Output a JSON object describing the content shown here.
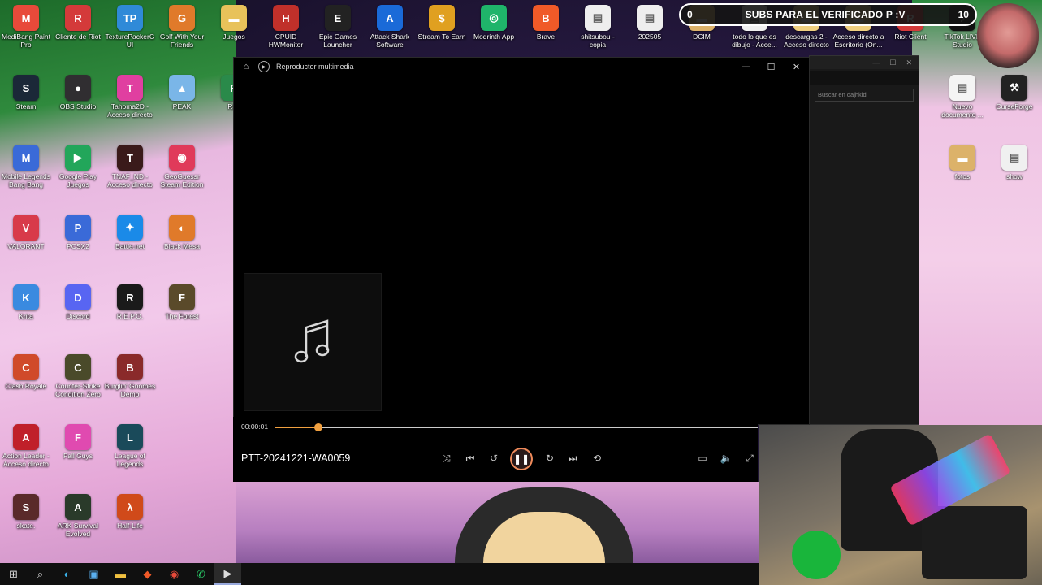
{
  "desktop_icons": [
    {
      "label": "MediBang Paint Pro",
      "color": "#e84a3a",
      "glyph": "M"
    },
    {
      "label": "Cliente de Riot",
      "color": "#d43a3a",
      "glyph": "R"
    },
    {
      "label": "TexturePackerGUI",
      "color": "#2f8ad8",
      "glyph": "TP"
    },
    {
      "label": "Golf With Your Friends",
      "color": "#e07a2a",
      "glyph": "G"
    },
    {
      "label": "Juegos",
      "color": "#e8c25a",
      "glyph": "▬"
    },
    {
      "label": "CPUID HWMonitor",
      "color": "#c0302a",
      "glyph": "H"
    },
    {
      "label": "Epic Games Launcher",
      "color": "#222222",
      "glyph": "E"
    },
    {
      "label": "Attack Shark Software",
      "color": "#1a6ad8",
      "glyph": "A"
    },
    {
      "label": "Stream To Earn",
      "color": "#e0a020",
      "glyph": "$"
    },
    {
      "label": "Modrinth App",
      "color": "#1fb46a",
      "glyph": "◎"
    },
    {
      "label": "Brave",
      "color": "#f05a28",
      "glyph": "B"
    },
    {
      "label": "shitsubou - copia",
      "color": "#eeeeee",
      "glyph": "▤"
    },
    {
      "label": "202505",
      "color": "#eeeeee",
      "glyph": "▤"
    },
    {
      "label": "DCIM",
      "color": "#dcb26a",
      "glyph": "▬"
    },
    {
      "label": "todo lo que es dibujo - Acce...",
      "color": "#f0f0f0",
      "glyph": "▤"
    },
    {
      "label": "descargas 2 - Acceso directo",
      "color": "#f0d080",
      "glyph": "▬"
    },
    {
      "label": "Acceso directo a Escritorio (On...",
      "color": "#f0d080",
      "glyph": "▬"
    },
    {
      "label": "Riot Client",
      "color": "#d43a3a",
      "glyph": "R"
    },
    {
      "label": "TikTok LIVE Studio",
      "color": "#111111",
      "glyph": "♪"
    },
    {
      "label": "Steam",
      "color": "#1b2838",
      "glyph": "S"
    },
    {
      "label": "OBS Studio",
      "color": "#302e31",
      "glyph": "●"
    },
    {
      "label": "Tahoma2D - Acceso directo",
      "color": "#e03fa0",
      "glyph": "T"
    },
    {
      "label": "PEAK",
      "color": "#7ab6e8",
      "glyph": "▲"
    },
    {
      "label": "Rad",
      "color": "#2a8a4a",
      "glyph": "R"
    },
    {
      "label": "Nuevo documento ...",
      "color": "#f4f4f4",
      "glyph": "▤"
    },
    {
      "label": "CurseForge",
      "color": "#222222",
      "glyph": "⚒"
    },
    {
      "label": "Mobile Legends Bang Bang",
      "color": "#3a6ad8",
      "glyph": "M"
    },
    {
      "label": "Google Play Juegos",
      "color": "#22a65a",
      "glyph": "▶"
    },
    {
      "label": "TNAF_ND - Acceso directo",
      "color": "#3a1a1a",
      "glyph": "T"
    },
    {
      "label": "GeoGuessr Steam Edition",
      "color": "#e03a5a",
      "glyph": "◉"
    },
    {
      "label": "fotos",
      "color": "#dcb26a",
      "glyph": "▬"
    },
    {
      "label": "show",
      "color": "#f0f0f0",
      "glyph": "▤"
    },
    {
      "label": "VALORANT",
      "color": "#d83a4a",
      "glyph": "V"
    },
    {
      "label": "PCSX2",
      "color": "#3a6ad8",
      "glyph": "P"
    },
    {
      "label": "Battle.net",
      "color": "#1a8ae8",
      "glyph": "✦"
    },
    {
      "label": "Black Mesa",
      "color": "#e07a2a",
      "glyph": "◐"
    },
    {
      "label": "Krita",
      "color": "#3a8ae0",
      "glyph": "K"
    },
    {
      "label": "Discord",
      "color": "#5865f2",
      "glyph": "D"
    },
    {
      "label": "R.E.P.O.",
      "color": "#1a1a1a",
      "glyph": "R"
    },
    {
      "label": "The Forest",
      "color": "#5a4a2a",
      "glyph": "F"
    },
    {
      "label": "Clash Royale",
      "color": "#d04a2a",
      "glyph": "C"
    },
    {
      "label": "Counter-Strike Condition Zero",
      "color": "#4a4a2a",
      "glyph": "C"
    },
    {
      "label": "Burglin' Gnomes Demo",
      "color": "#8a2a2a",
      "glyph": "B"
    },
    {
      "label": "Action Leader - Acceso directo",
      "color": "#c0202a",
      "glyph": "A"
    },
    {
      "label": "Fall Guys",
      "color": "#e04ab0",
      "glyph": "F"
    },
    {
      "label": "League of Legends",
      "color": "#1a4a5a",
      "glyph": "L"
    },
    {
      "label": "skate.",
      "color": "#5a2a2a",
      "glyph": "S"
    },
    {
      "label": "ARK Survival Evolved",
      "color": "#2a3a2a",
      "glyph": "A"
    },
    {
      "label": "Half-Life",
      "color": "#d04a1a",
      "glyph": "λ"
    }
  ],
  "banner": {
    "left": "0",
    "text": "SUBS PARA EL VERIFICADO P :V",
    "right": "10"
  },
  "explorer": {
    "search_placeholder": "Buscar en dajhkld"
  },
  "player": {
    "title": "Reproductor multimedia",
    "current_time": "00:00:01",
    "progress": 0.09,
    "track_title": "PTT-20241221-WA0059",
    "accent": "#f0a040"
  }
}
